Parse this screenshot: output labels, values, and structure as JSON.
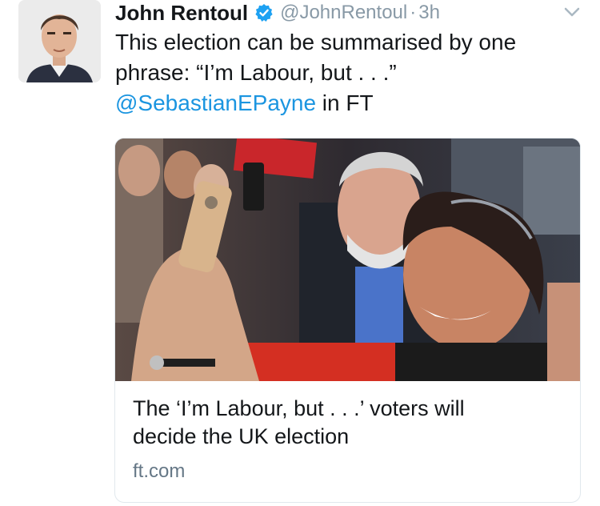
{
  "author": {
    "name": "John Rentoul",
    "handle": "@JohnRentoul",
    "separator": "·",
    "time": "3h",
    "verified_color": "#1da1f2"
  },
  "tweet": {
    "line1": "This election can be summarised by one",
    "line2": "phrase: “I’m Labour, but . . .”",
    "mention": "@SebastianEPayne",
    "after_mention": " in FT"
  },
  "card": {
    "title_line1": "The ‘I’m Labour, but . . .’ voters will",
    "title_line2": "decide the UK election",
    "domain": "ft.com"
  },
  "icons": {
    "verified": "verified-badge-icon",
    "menu": "chevron-down-icon"
  },
  "colors": {
    "link": "#1b95e0",
    "meta": "#8899a6"
  }
}
